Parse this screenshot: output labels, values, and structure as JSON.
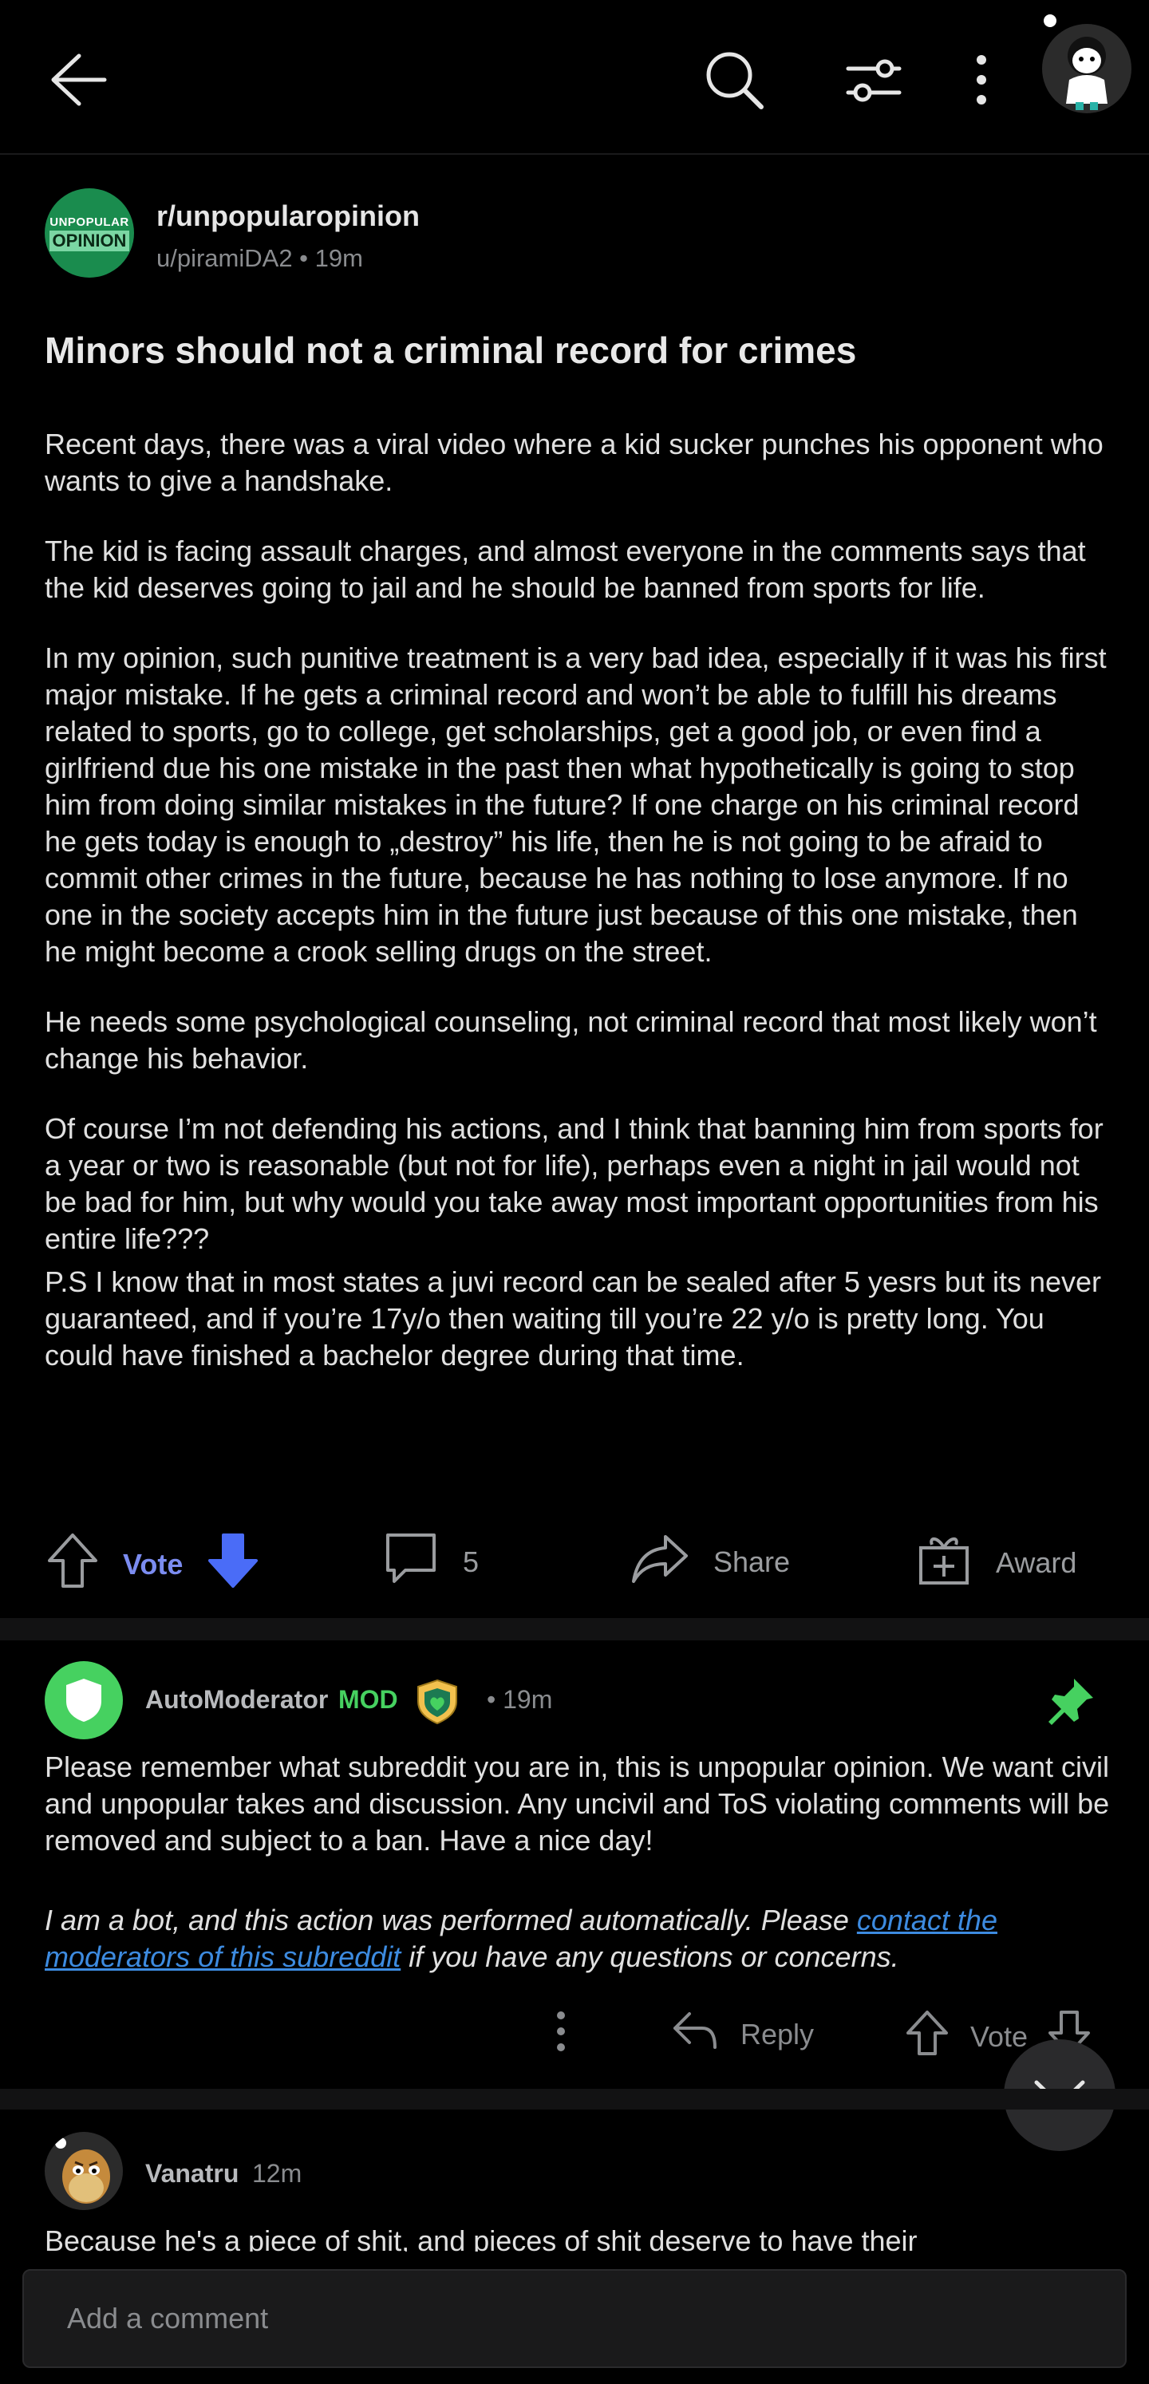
{
  "header": {
    "back_icon": "arrow-left-icon",
    "search_icon": "search-icon",
    "filter_icon": "sliders-icon",
    "more_icon": "kebab-menu-icon"
  },
  "post": {
    "subreddit_avatar_line1": "UNPOPULAR",
    "subreddit_avatar_line2": "OPINION",
    "subreddit": "r/unpopularopinion",
    "author": "u/piramiDA2",
    "age": " • 19m",
    "title": "Minors should not a criminal record for crimes",
    "paragraphs": [
      "Recent days, there was a viral video where a kid sucker punches his opponent who wants to give a handshake.",
      "The kid is facing assault charges, and almost everyone in the comments says that the kid deserves going to jail and he should be banned from sports for life.",
      "In my opinion, such punitive treatment is a very bad idea, especially if it was his first major mistake. If he gets a criminal record and won’t be able to fulfill his dreams related to sports, go to college, get scholarships, get a good job, or even find a girlfriend due his one mistake in the past then what hypothetically is going to stop him from doing similar mistakes in the future? If one charge on his criminal record he gets today is enough to „destroy” his life, then he is not going to be afraid to commit other crimes in the future, because he has nothing to lose anymore. If no one in the society accepts him in the future just because of this one mistake, then he might become a crook selling drugs on the street.",
      "He needs some psychological counseling, not criminal record that most likely won’t change his behavior.",
      "Of course I’m not defending his actions, and I think that banning him from sports for a year or two is reasonable (but not for life), perhaps even a night in jail would not be bad for him, but why would you take away most important opportunities from his entire life???",
      "P.S I know that in most states a juvi record can be sealed after 5 yesrs but its never guaranteed, and if you’re 17y/o then waiting till you’re 22 y/o is pretty long. You could have finished a bachelor degree during that time."
    ],
    "actions": {
      "vote_label": "Vote",
      "comment_count": "5",
      "share_label": "Share",
      "award_label": "Award"
    }
  },
  "comments": [
    {
      "author": "AutoModerator",
      "mod_tag": "MOD",
      "age": "• 19m",
      "body": "Please remember what subreddit you are in, this is unpopular opinion. We want civil and unpopular takes and discussion. Any uncivil and ToS violating comments will be removed and subject to a ban. Have a nice day!",
      "bot_note_before": "I am a bot, and this action was performed automatically. Please ",
      "bot_note_link": "contact the moderators of this subreddit",
      "bot_note_after": " if you have any questions or concerns.",
      "reply_label": "Reply",
      "vote_label": "Vote"
    },
    {
      "author": "Vanatru",
      "age": "12m",
      "body": "Because he's a piece of shit, and pieces of shit deserve to have their"
    }
  ],
  "composer": {
    "placeholder": "Add a comment"
  },
  "colors": {
    "background": "#000000",
    "vote_accent": "#7b8cf0",
    "downvote": "#4a6cf7",
    "mod_green": "#46d160",
    "link": "#3d8be0"
  }
}
